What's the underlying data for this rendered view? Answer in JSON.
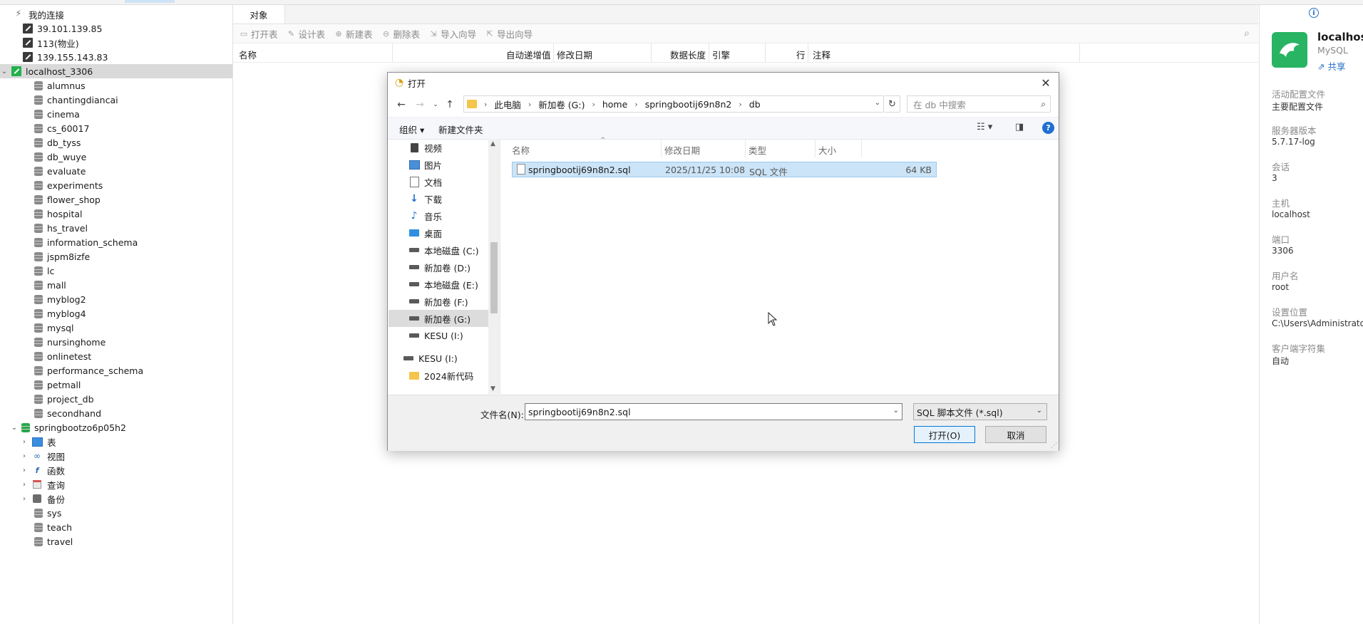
{
  "navigator": {
    "root_label": "我的连接",
    "items": [
      {
        "label": "39.101.139.85",
        "kind": "conn"
      },
      {
        "label": "113(物业)",
        "kind": "conn"
      },
      {
        "label": "139.155.143.83",
        "kind": "conn"
      },
      {
        "label": "localhost_3306",
        "kind": "conn-open"
      },
      {
        "label": "alumnus",
        "kind": "db"
      },
      {
        "label": "chantingdiancai",
        "kind": "db"
      },
      {
        "label": "cinema",
        "kind": "db"
      },
      {
        "label": "cs_60017",
        "kind": "db"
      },
      {
        "label": "db_tyss",
        "kind": "db"
      },
      {
        "label": "db_wuye",
        "kind": "db"
      },
      {
        "label": "evaluate",
        "kind": "db"
      },
      {
        "label": "experiments",
        "kind": "db"
      },
      {
        "label": "flower_shop",
        "kind": "db"
      },
      {
        "label": "hospital",
        "kind": "db"
      },
      {
        "label": "hs_travel",
        "kind": "db"
      },
      {
        "label": "information_schema",
        "kind": "db"
      },
      {
        "label": "jspm8izfe",
        "kind": "db"
      },
      {
        "label": "lc",
        "kind": "db"
      },
      {
        "label": "mall",
        "kind": "db"
      },
      {
        "label": "myblog2",
        "kind": "db"
      },
      {
        "label": "myblog4",
        "kind": "db"
      },
      {
        "label": "mysql",
        "kind": "db"
      },
      {
        "label": "nursinghome",
        "kind": "db"
      },
      {
        "label": "onlinetest",
        "kind": "db"
      },
      {
        "label": "performance_schema",
        "kind": "db"
      },
      {
        "label": "petmall",
        "kind": "db"
      },
      {
        "label": "project_db",
        "kind": "db"
      },
      {
        "label": "secondhand",
        "kind": "db"
      },
      {
        "label": "springbootzo6p05h2",
        "kind": "db-open"
      },
      {
        "label": "表",
        "kind": "sub",
        "icon": "table-icon"
      },
      {
        "label": "视图",
        "kind": "sub",
        "icon": "view-icon"
      },
      {
        "label": "函数",
        "kind": "sub",
        "icon": "function-icon"
      },
      {
        "label": "查询",
        "kind": "sub",
        "icon": "query-icon"
      },
      {
        "label": "备份",
        "kind": "sub",
        "icon": "backup-icon"
      },
      {
        "label": "sys",
        "kind": "db"
      },
      {
        "label": "teach",
        "kind": "db"
      },
      {
        "label": "travel",
        "kind": "db"
      }
    ]
  },
  "center": {
    "tab_label": "对象",
    "toolbar": {
      "open_table": "打开表",
      "design_table": "设计表",
      "new_table": "新建表",
      "delete_table": "删除表",
      "import_wizard": "导入向导",
      "export_wizard": "导出向导"
    },
    "columns": [
      "名称",
      "自动递增值",
      "修改日期",
      "数据长度",
      "引擎",
      "行",
      "注释"
    ]
  },
  "info_panel": {
    "name": "localhost",
    "type": "MySQL",
    "share": "共享",
    "fields": [
      {
        "key": "活动配置文件",
        "value": "主要配置文件"
      },
      {
        "key": "服务器版本",
        "value": "5.7.17-log"
      },
      {
        "key": "会话",
        "value": "3"
      },
      {
        "key": "主机",
        "value": "localhost"
      },
      {
        "key": "端口",
        "value": "3306"
      },
      {
        "key": "用户名",
        "value": "root"
      },
      {
        "key": "设置位置",
        "value": "C:\\Users\\Administrato"
      },
      {
        "key": "客户端字符集",
        "value": "自动"
      }
    ]
  },
  "dialog": {
    "title": "打开",
    "breadcrumb": [
      "此电脑",
      "新加卷 (G:)",
      "home",
      "springbootij69n8n2",
      "db"
    ],
    "search_placeholder": "在 db 中搜索",
    "organize": "组织 ▾",
    "new_folder": "新建文件夹",
    "tree": [
      {
        "label": "视频",
        "icon": "video-icon"
      },
      {
        "label": "图片",
        "icon": "pictures-icon"
      },
      {
        "label": "文档",
        "icon": "documents-icon"
      },
      {
        "label": "下载",
        "icon": "download-icon"
      },
      {
        "label": "音乐",
        "icon": "music-icon"
      },
      {
        "label": "桌面",
        "icon": "desktop-icon"
      },
      {
        "label": "本地磁盘 (C:)",
        "icon": "drive-icon"
      },
      {
        "label": "新加卷 (D:)",
        "icon": "drive-icon"
      },
      {
        "label": "本地磁盘 (E:)",
        "icon": "drive-icon"
      },
      {
        "label": "新加卷 (F:)",
        "icon": "drive-icon"
      },
      {
        "label": "新加卷 (G:)",
        "icon": "drive-icon",
        "selected": true
      },
      {
        "label": "KESU  (I:)",
        "icon": "drive-icon"
      },
      {
        "label": "KESU  (I:)",
        "icon": "drive-icon"
      },
      {
        "label": "2024新代码",
        "icon": "folder-icon"
      }
    ],
    "file_columns": [
      "名称",
      "修改日期",
      "类型",
      "大小"
    ],
    "files": [
      {
        "name": "springbootij69n8n2.sql",
        "date": "2025/11/25 10:08",
        "type": "SQL 文件",
        "size": "64 KB"
      }
    ],
    "filename_label": "文件名(N):",
    "filename_value": "springbootij69n8n2.sql",
    "filetype_value": "SQL 脚本文件 (*.sql)",
    "open_button": "打开(O)",
    "cancel_button": "取消"
  }
}
